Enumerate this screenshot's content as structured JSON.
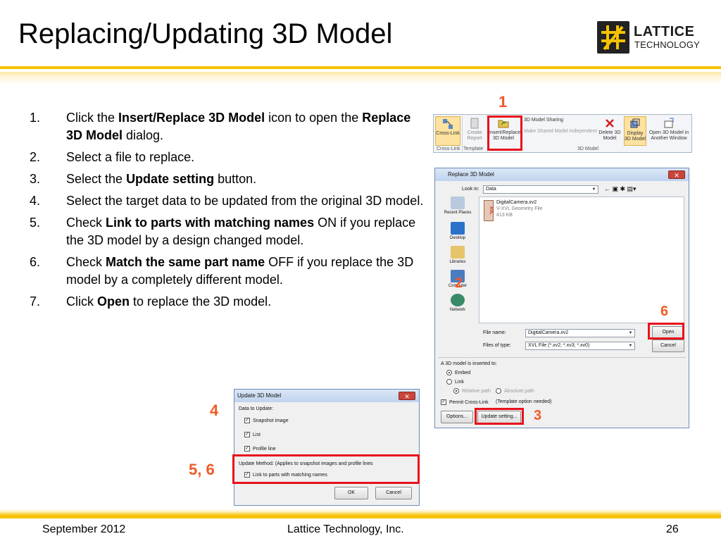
{
  "slide": {
    "title": "Replacing/Updating 3D Model",
    "logo": {
      "line1": "LATTICE",
      "line2": "TECHNOLOGY"
    }
  },
  "steps": [
    {
      "num": "1.",
      "parts": [
        "Click the ",
        "Insert/Replace 3D Model",
        " icon to open the ",
        "Replace 3D Model",
        " dialog."
      ]
    },
    {
      "num": "2.",
      "parts": [
        "Select a file to replace."
      ]
    },
    {
      "num": "3.",
      "parts": [
        "Select the ",
        "Update setting",
        " button."
      ]
    },
    {
      "num": "4.",
      "parts": [
        "Select the target data to be updated from the original 3D model."
      ]
    },
    {
      "num": "5.",
      "parts": [
        "Check ",
        "Link to parts with matching names",
        " ON if you replace the 3D model by a design changed model."
      ]
    },
    {
      "num": "6.",
      "parts": [
        "Check ",
        "Match the same part name",
        " OFF if you replace the 3D model by a completely different model."
      ]
    },
    {
      "num": "7.",
      "parts": [
        "Click ",
        "Open",
        " to replace the 3D model."
      ]
    }
  ],
  "callouts": {
    "c1": "1",
    "c2": "2",
    "c3": "3",
    "c4": "4",
    "c56": "5, 6",
    "c6": "6"
  },
  "ribbon": {
    "cross_link": "Cross-Link",
    "create_report_1": "Create",
    "create_report_2": "Report",
    "insert_replace_1": "Insert/Replace",
    "insert_replace_2": "3D Model",
    "sharing": "3D Model Sharing",
    "make_shared": "Make Shared Model Independent",
    "delete_1": "Delete 3D",
    "delete_2": "Model",
    "display_1": "Display",
    "display_2": "3D Model",
    "open_another_1": "Open 3D Model in",
    "open_another_2": "Another Window",
    "group_cross": "Cross-Link",
    "group_template": "Template",
    "group_3d": "3D Model"
  },
  "replace_dialog": {
    "title": "Replace 3D Model",
    "look_in_label": "Look in:",
    "look_in_value": "Data",
    "places": [
      "Recent Places",
      "Desktop",
      "Libraries",
      "Computer",
      "Network"
    ],
    "file": {
      "name": "DigitalCamera.xv2",
      "type": "V-XVL Geometry File",
      "size": "413 KB",
      "icon_text": "XVL"
    },
    "file_name_label": "File name:",
    "file_name_value": "DigitalCamera.xv2",
    "file_type_label": "Files of type:",
    "file_type_value": "XVL File (*.xv2; *.xv3; *.xv0)",
    "open_btn": "Open",
    "cancel_btn": "Cancel",
    "inserted_label": "A 3D model is inserted to:",
    "embed": "Embed",
    "link": "Link",
    "relative_path": "Relative path",
    "absolute_path": "Absolute path",
    "permit": "Permit Cross-Link",
    "template_needed": "(Template option needed)",
    "options_btn": "Options...",
    "update_btn": "Update setting..."
  },
  "update_dialog": {
    "title": "Update 3D Model",
    "data_to_update": "Data to Update:",
    "snapshot": "Snapshot image",
    "list": "List",
    "profile": "Profile line",
    "method": "Update Method: (Applies to snapshot images and profile lines",
    "link_parts": "Link to parts with matching names",
    "ok": "OK",
    "cancel": "Cancel"
  },
  "footer": {
    "date": "September 2012",
    "company": "Lattice Technology, Inc.",
    "page": "26"
  },
  "colors": {
    "accent": "#f6c200",
    "callout": "#f15a24",
    "highlight": "#e8111b"
  }
}
